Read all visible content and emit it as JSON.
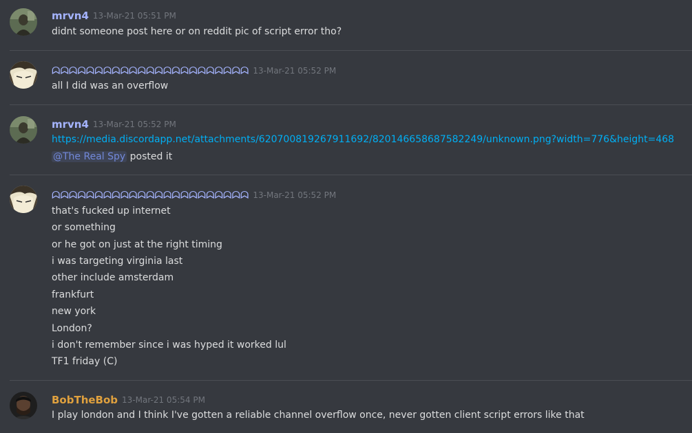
{
  "messages": [
    {
      "author": "mrvn4",
      "timestamp": "13-Mar-21 05:51 PM",
      "avatar": "mrvn4-avatar",
      "lines": [
        "didnt someone post here or on reddit pic of script error tho?"
      ]
    },
    {
      "author": "ᗣᗣᗣᗣᗣᗣᗣᗣᗣᗣᗣᗣᗣᗣᗣᗣᗣᗣᗣᗣᗣᗣᗣ",
      "timestamp": "13-Mar-21 05:52 PM",
      "avatar": "anime-avatar",
      "lines": [
        "all I did was an overflow"
      ]
    },
    {
      "author": "mrvn4",
      "timestamp": "13-Mar-21 05:52 PM",
      "avatar": "mrvn4-avatar",
      "link": "https://media.discordapp.net/attachments/620700819267911692/820146658687582249/unknown.png?width=776&height=468",
      "mention": "@The Real Spy",
      "mention_suffix": " posted it"
    },
    {
      "author": "ᗣᗣᗣᗣᗣᗣᗣᗣᗣᗣᗣᗣᗣᗣᗣᗣᗣᗣᗣᗣᗣᗣᗣ",
      "timestamp": "13-Mar-21 05:52 PM",
      "avatar": "anime-avatar",
      "lines": [
        "that's fucked up internet",
        "or something",
        "or he got on just at the right timing",
        "i was targeting virginia last",
        "other include amsterdam",
        "frankfurt",
        "new york",
        "London?",
        "i don't remember since i was hyped it worked lul",
        "TF1 friday (C)"
      ]
    },
    {
      "author": "BobTheBob",
      "timestamp": "13-Mar-21 05:54 PM",
      "avatar": "bob-avatar",
      "lines": [
        "I play london and I think I've gotten a reliable channel overflow once, never gotten client script errors like that"
      ]
    }
  ],
  "colors": {
    "background": "#36393f",
    "author_default": "#a5b4ff",
    "author_bob": "#e0a13e",
    "link": "#00aff4",
    "mention": "#7289da",
    "text": "#dcddde",
    "timestamp": "#72767d"
  }
}
